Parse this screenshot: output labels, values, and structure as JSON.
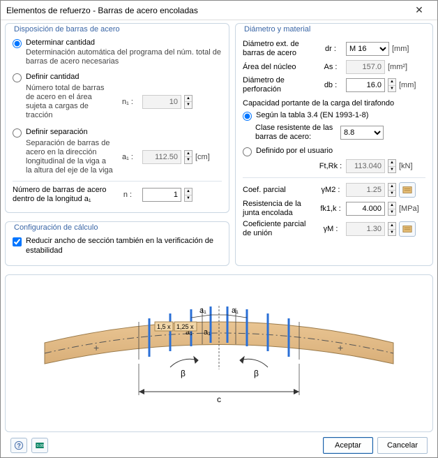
{
  "title": "Elementos de refuerzo - Barras de acero encoladas",
  "left": {
    "group1_title": "Disposición de barras de acero",
    "opt1_label": "Determinar cantidad",
    "opt1_desc": "Determinación automática del programa del núm. total de barras de acero necesarias",
    "opt2_label": "Definir cantidad",
    "opt2_desc": "Número total de barras de acero en el área sujeta a cargas de tracción",
    "opt2_sym": "n₁ :",
    "opt2_val": "10",
    "opt3_label": "Definir separación",
    "opt3_desc": "Separación de barras de acero en la dirección longitudinal de la viga a la altura del eje de la viga",
    "opt3_sym": "a₁ :",
    "opt3_val": "112.50",
    "opt3_unit": "[cm]",
    "bars_label": "Número de barras de acero dentro de la longitud a₁",
    "bars_sym": "n :",
    "bars_val": "1",
    "group2_title": "Configuración de cálculo",
    "chk_label": "Reducir ancho de sección también en la verificación de estabilidad"
  },
  "right": {
    "group_title": "Diámetro y material",
    "dia_label": "Diámetro ext. de barras de acero",
    "dia_sym": "dr :",
    "dia_val": "M 16",
    "dia_unit": "[mm]",
    "area_label": "Área del núcleo",
    "area_sym": "As :",
    "area_val": "157.0",
    "area_unit": "[mm²]",
    "bore_label": "Diámetro de perforación",
    "bore_sym": "db :",
    "bore_val": "16.0",
    "bore_unit": "[mm]",
    "cap_heading": "Capacidad portante de la carga del tirafondo",
    "cap_opt1": "Según la tabla 3.4 (EN 1993-1-8)",
    "class_label": "Clase resistente de las barras de acero:",
    "class_val": "8.8",
    "cap_opt2": "Definido por el usuario",
    "ftrk_sym": "Ft,Rk :",
    "ftrk_val": "113.040",
    "ftrk_unit": "[kN]",
    "coef_label": "Coef. parcial",
    "coef_sym": "γM2 :",
    "coef_val": "1.25",
    "joint_label": "Resistencia de la junta encolada",
    "joint_sym": "fk1,k :",
    "joint_val": "4.000",
    "joint_unit": "[MPa]",
    "union_label": "Coeficiente parcial de unión",
    "union_sym": "γM :",
    "union_val": "1.30"
  },
  "diagram": {
    "a1": "a₁",
    "m15": "1,5 x",
    "m125": "1,25 x",
    "beta": "β",
    "c": "c"
  },
  "footer": {
    "ok": "Aceptar",
    "cancel": "Cancelar"
  }
}
